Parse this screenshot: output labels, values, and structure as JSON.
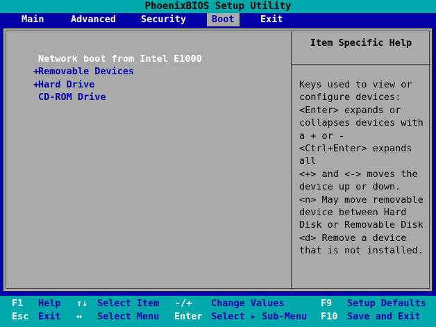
{
  "title": "PhoenixBIOS Setup Utility",
  "menu": [
    {
      "label": "Main"
    },
    {
      "label": "Advanced"
    },
    {
      "label": "Security"
    },
    {
      "label": "Boot"
    },
    {
      "label": "Exit"
    }
  ],
  "active_menu": "Boot",
  "boot_list": [
    {
      "prefix": "",
      "label": "Network boot from Intel E1000"
    },
    {
      "prefix": "+",
      "label": "Removable Devices"
    },
    {
      "prefix": "+",
      "label": "Hard Drive"
    },
    {
      "prefix": "",
      "label": "CD-ROM Drive"
    }
  ],
  "help": {
    "title": "Item Specific Help",
    "text": "Keys used to view or\nconfigure devices:\n<Enter> expands or\ncollapses devices with\na + or -\n<Ctrl+Enter> expands\nall\n<+> and <-> moves the\ndevice up or down.\n<n> May move removable\ndevice between Hard\nDisk or Removable Disk\n<d> Remove a device\nthat is not installed."
  },
  "footer": {
    "row1": [
      {
        "key": "F1",
        "desc": "Help"
      },
      {
        "key": "↑↓",
        "desc": "Select Item"
      },
      {
        "key": "-/+",
        "desc": "Change Values"
      },
      {
        "key": "F9",
        "desc": "Setup Defaults"
      }
    ],
    "row2": [
      {
        "key": "Esc",
        "desc": "Exit"
      },
      {
        "key": "↔",
        "desc": "Select Menu"
      },
      {
        "key": "Enter",
        "desc": "Select ▸ Sub-Menu"
      },
      {
        "key": "F10",
        "desc": "Save and Exit"
      }
    ]
  },
  "colors": {
    "background": "#0000a8",
    "panel": "#aaaaaa",
    "bars": "#00aaaa",
    "highlight_text": "#ffffff"
  }
}
